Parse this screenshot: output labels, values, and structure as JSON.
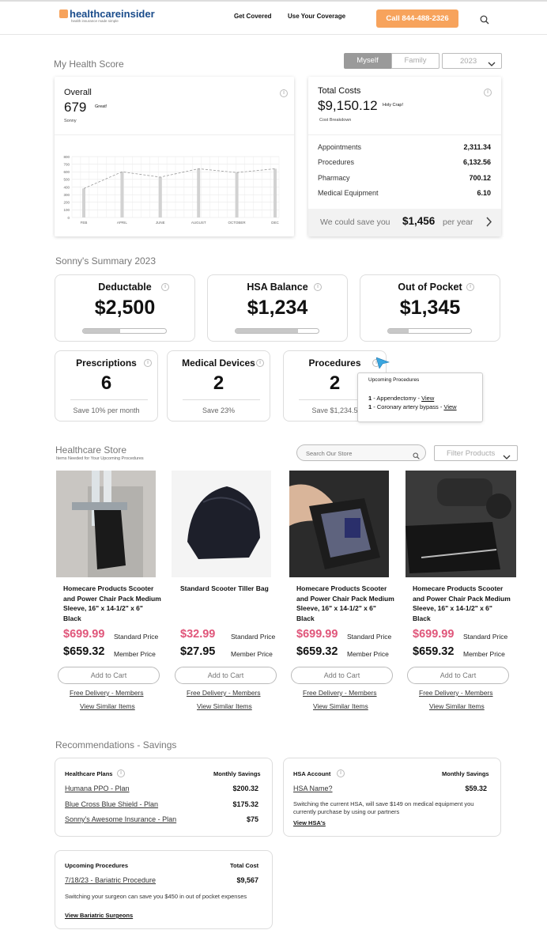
{
  "header": {
    "logo_main": "healthcareinsider",
    "logo_sub": "health insurance made simple",
    "nav": [
      "Get Covered",
      "Use Your Coverage"
    ],
    "call_button": "Call 844-488-2326"
  },
  "health_score": {
    "title": "My Health Score",
    "toggle": [
      "Myself",
      "Family"
    ],
    "year": "2023",
    "overall": {
      "label": "Overall",
      "score": "679",
      "score_note": "Great!",
      "name": "Sonny"
    },
    "total_costs": {
      "label": "Total Costs",
      "amount": "$9,150.12",
      "note": "Holy Crap!",
      "sub": "Cost Breakdown",
      "rows": [
        {
          "label": "Appointments",
          "value": "2,311.34"
        },
        {
          "label": "Procedures",
          "value": "6,132.56"
        },
        {
          "label": "Pharmacy",
          "value": "700.12"
        },
        {
          "label": "Medical Equipment",
          "value": "6.10"
        }
      ],
      "save_prefix": "We could save you",
      "save_amount": "$1,456",
      "save_suffix": "per year"
    }
  },
  "chart_data": {
    "type": "bar",
    "categories": [
      "FEB",
      "APRIL",
      "JUNE",
      "AUGUST",
      "OCTOBER",
      "DEC"
    ],
    "values": [
      380,
      600,
      530,
      640,
      590,
      640
    ],
    "line_values": [
      380,
      600,
      530,
      640,
      590,
      640
    ],
    "yticks": [
      "0",
      "100",
      "200",
      "300",
      "400",
      "500",
      "600",
      "700",
      "800"
    ],
    "ylim": [
      0,
      800
    ],
    "grid": true
  },
  "summary": {
    "title": "Sonny's Summary 2023",
    "tiles": [
      {
        "label": "Deductable",
        "value": "$2,500",
        "progress": 0.45
      },
      {
        "label": "HSA Balance",
        "value": "$1,234",
        "progress": 0.75
      },
      {
        "label": "Out of Pocket",
        "value": "$1,345",
        "progress": 0.25
      }
    ],
    "small_tiles": [
      {
        "label": "Prescriptions",
        "value": "6",
        "note": "Save 10% per month"
      },
      {
        "label": "Medical Devices",
        "value": "2",
        "note": "Save 23%"
      },
      {
        "label": "Procedures",
        "value": "2",
        "note": "Save $1,234.5"
      }
    ],
    "tooltip": {
      "title": "Upcoming Procedures",
      "items": [
        {
          "num": "1",
          "text": " - Appendectomy - ",
          "link": "View"
        },
        {
          "num": "1",
          "text": " - Coronary artery bypass - ",
          "link": "View"
        }
      ]
    }
  },
  "store": {
    "title": "Healthcare Store",
    "subtitle": "Items Needed for Your Upcoming Procedures",
    "search_placeholder": "Search Our Store",
    "filter": "Filter Products",
    "products": [
      {
        "name": "Homecare Products Scooter and Power Chair Pack Medium Sleeve, 16\" x 14-1/2\" x 6\" Black",
        "price": "$699.99",
        "price_label": "Standard Price",
        "member": "$659.32",
        "member_label": "Member Price",
        "cart": "Add to Cart",
        "delivery": "Free Delivery - Members",
        "similar": "View Similar Items"
      },
      {
        "name": "Standard Scooter Tiller Bag",
        "price": "$32.99",
        "price_label": "Standard Price",
        "member": "$27.95",
        "member_label": "Member Price",
        "cart": "Add to Cart",
        "delivery": "Free Delivery - Members",
        "similar": "View Similar Items"
      },
      {
        "name": "Homecare Products Scooter and Power Chair Pack Medium Sleeve, 16\" x 14-1/2\" x 6\" Black",
        "price": "$699.99",
        "price_label": "Standard Price",
        "member": "$659.32",
        "member_label": "Member Price",
        "cart": "Add to Cart",
        "delivery": "Free Delivery - Members",
        "similar": "View Similar Items"
      },
      {
        "name": "Homecare Products Scooter and Power Chair Pack Medium Sleeve, 16\" x 14-1/2\" x 6\" Black",
        "price": "$699.99",
        "price_label": "Standard Price",
        "member": "$659.32",
        "member_label": "Member Price",
        "cart": "Add to Cart",
        "delivery": "Free Delivery - Members",
        "similar": "View Similar Items"
      }
    ]
  },
  "recommendations": {
    "title": "Recommendations - Savings",
    "plans": {
      "header": "Healthcare Plans",
      "col": "Monthly Savings",
      "rows": [
        {
          "label": "Humana PPO - Plan",
          "value": "$200.32"
        },
        {
          "label": "Blue Cross Blue Shield - Plan",
          "value": "$175.32"
        },
        {
          "label": "Sonny's Awesome Insurance - Plan",
          "value": "$75"
        }
      ]
    },
    "hsa": {
      "header": "HSA Account",
      "col": "Monthly Savings",
      "row_label": "HSA Name?",
      "row_value": "$59.32",
      "note": "Switching the current HSA, will save $149 on medical equipment you currently purchase by using our partners",
      "link": "View HSA's"
    },
    "procedures": {
      "header": "Upcoming Procedures",
      "col": "Total Cost",
      "row_label": "7/18/23 - Bariatric Procedure",
      "row_value": "$9,567",
      "note": "Switching your surgeon can save you $450 in out of pocket expenses",
      "link": "View Bariatric Surgeons"
    }
  },
  "colors": {
    "accent": "#f7a35c",
    "price_red": "#e0567a",
    "logo_blue": "#1a4c8b"
  }
}
